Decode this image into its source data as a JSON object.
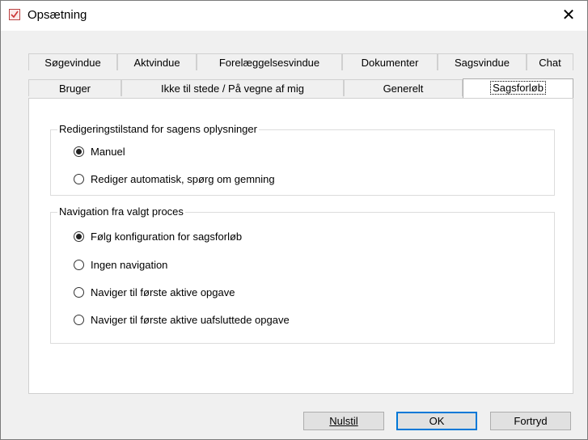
{
  "window": {
    "title": "Opsætning"
  },
  "tabs_row_top": [
    {
      "label": "Søgevindue"
    },
    {
      "label": "Aktvindue"
    },
    {
      "label": "Forelæggelsesvindue"
    },
    {
      "label": "Dokumenter"
    },
    {
      "label": "Sagsvindue"
    },
    {
      "label": "Chat"
    }
  ],
  "tabs_row_bottom": [
    {
      "label": "Bruger"
    },
    {
      "label": "Ikke til stede / På vegne af mig"
    },
    {
      "label": "Generelt"
    },
    {
      "label": "Sagsforløb",
      "active": true
    }
  ],
  "group_editing": {
    "legend": "Redigeringstilstand for sagens oplysninger",
    "options": [
      {
        "label": "Manuel",
        "checked": true
      },
      {
        "label": "Rediger automatisk, spørg om gemning",
        "checked": false
      }
    ]
  },
  "group_navigation": {
    "legend": "Navigation fra valgt proces",
    "options": [
      {
        "label": "Følg konfiguration for sagsforløb",
        "checked": true
      },
      {
        "label": "Ingen navigation",
        "checked": false
      },
      {
        "label": "Naviger til første aktive opgave",
        "checked": false
      },
      {
        "label": "Naviger til første aktive uafsluttede opgave",
        "checked": false
      }
    ]
  },
  "buttons": {
    "reset": "Nulstil",
    "ok": "OK",
    "cancel": "Fortryd"
  },
  "icons": {
    "app": "settings-checklist-icon",
    "close": "close-icon"
  },
  "colors": {
    "titlebar": "#ffffff",
    "dialog_bg": "#f0f0f0",
    "default_button_border": "#0078d7"
  }
}
